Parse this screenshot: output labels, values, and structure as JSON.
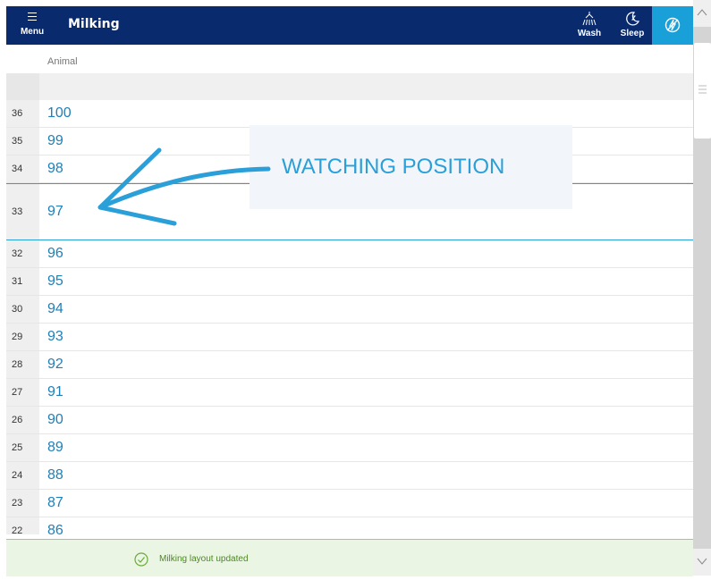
{
  "header": {
    "menu_label": "Menu",
    "title": "Milking",
    "actions": [
      {
        "label": "Wash",
        "icon": "shower-icon"
      },
      {
        "label": "Sleep",
        "icon": "moon-icon"
      }
    ],
    "power_icon": "power-off-icon",
    "colors": {
      "bar": "#0a2a6e",
      "power": "#1aa0d8"
    }
  },
  "table": {
    "column_header": "Animal",
    "rows": [
      {
        "index": "36",
        "animal": "100"
      },
      {
        "index": "35",
        "animal": "99"
      },
      {
        "index": "34",
        "animal": "98"
      },
      {
        "index": "33",
        "animal": "97",
        "watching": true
      },
      {
        "index": "32",
        "animal": "96"
      },
      {
        "index": "31",
        "animal": "95"
      },
      {
        "index": "30",
        "animal": "94"
      },
      {
        "index": "29",
        "animal": "93"
      },
      {
        "index": "28",
        "animal": "92"
      },
      {
        "index": "27",
        "animal": "91"
      },
      {
        "index": "26",
        "animal": "90"
      },
      {
        "index": "25",
        "animal": "89"
      },
      {
        "index": "24",
        "animal": "88"
      },
      {
        "index": "23",
        "animal": "87"
      },
      {
        "index": "22",
        "animal": "86"
      }
    ]
  },
  "annotation": {
    "text": "WATCHING POSITION",
    "color": "#2a9fd8"
  },
  "toast": {
    "text": "Milking layout updated",
    "icon": "check-circle-icon",
    "color": "#4a8a1f"
  }
}
